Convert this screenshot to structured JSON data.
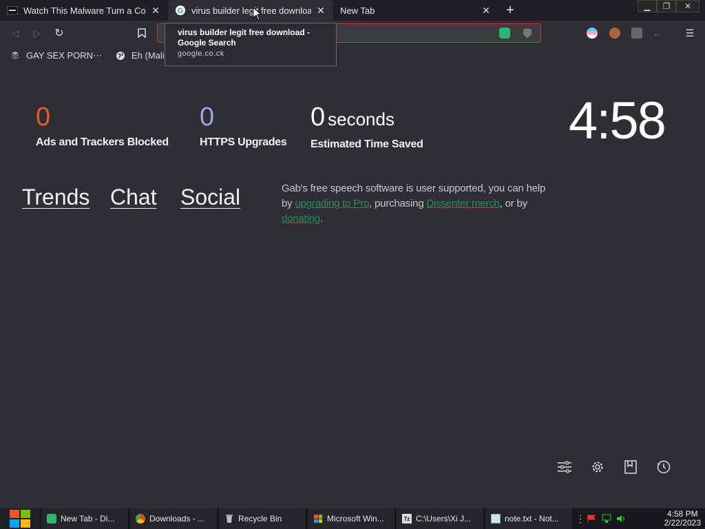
{
  "tabs": [
    {
      "title": "Watch This Malware Turn a Com",
      "active": false
    },
    {
      "title": "virus builder legit free download -",
      "active": true
    },
    {
      "title": "New Tab",
      "active": false
    }
  ],
  "tooltip": {
    "title": "virus builder legit free download - Google Search",
    "domain": "google.co.ck"
  },
  "bookmarks": [
    {
      "label": "GAY SEX PORN⋯"
    },
    {
      "label": "Eh (Malic"
    }
  ],
  "stats": [
    {
      "value": "0",
      "label": "Ads and Trackers Blocked",
      "color": "#e25a3b"
    },
    {
      "value": "0",
      "label": "HTTPS Upgrades",
      "color": "#a3a3e8"
    },
    {
      "value": "0",
      "unit": "seconds",
      "label": "Estimated Time Saved",
      "color": "#ffffff"
    }
  ],
  "clock": "4:58",
  "links": [
    "Trends",
    "Chat",
    "Social"
  ],
  "promo": {
    "p1": "Gab's free speech software is user supported, you can help by ",
    "link1": "upgrading to Pro",
    "p2": ", purchasing ",
    "link2": "Dissenter merch",
    "p3": ", or by ",
    "link3": "donating",
    "p4": "."
  },
  "taskbar": {
    "items": [
      {
        "label": "New Tab - Di..."
      },
      {
        "label": "Downloads - ..."
      },
      {
        "label": "Recycle Bin"
      },
      {
        "label": "Microsoft Win..."
      },
      {
        "label": "C:\\Users\\Xi J..."
      },
      {
        "label": "note.txt - Not..."
      }
    ],
    "time": "4:58 PM",
    "date": "2/22/2023"
  },
  "colors": {
    "accent_green": "#2b8c5e",
    "accent_orange": "#e25a3b",
    "accent_purple": "#a3a3e8"
  }
}
